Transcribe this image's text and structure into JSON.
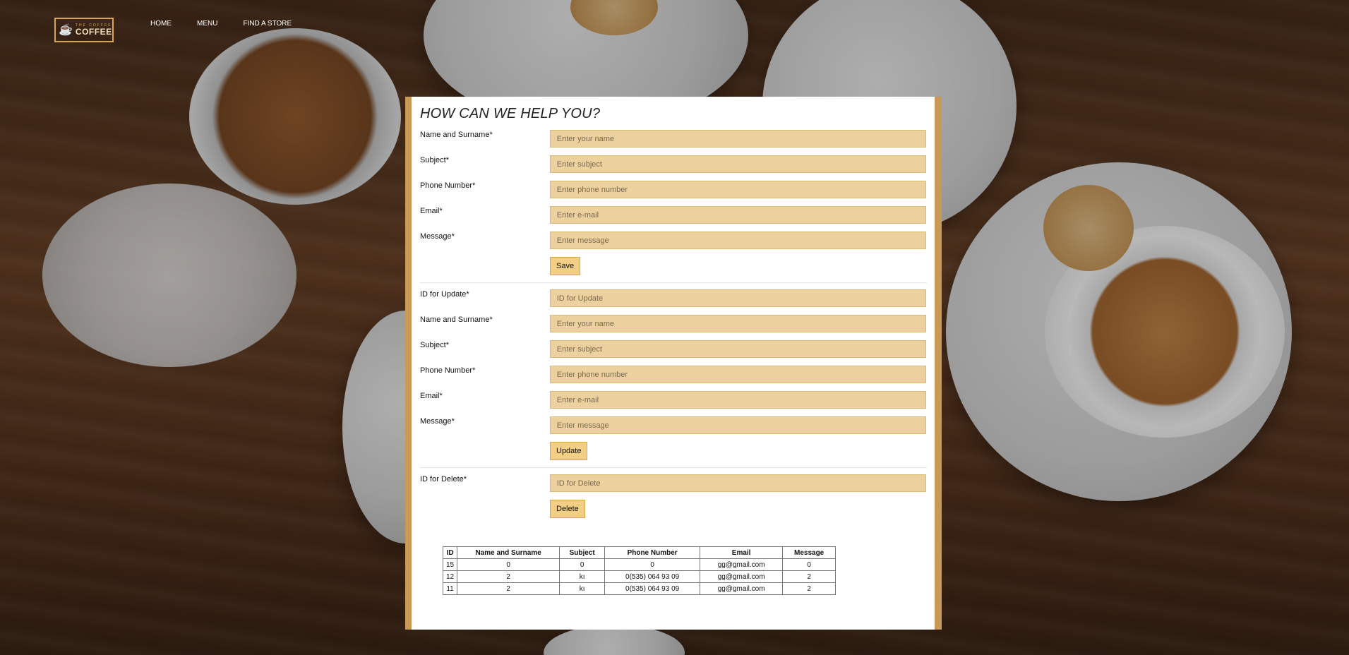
{
  "header": {
    "logo_small": "THE COFFEE",
    "logo_big": "COFFEE",
    "nav": [
      "HOME",
      "MENU",
      "FIND A STORE"
    ]
  },
  "form": {
    "title": "HOW CAN WE HELP YOU?",
    "save_section": {
      "fields": [
        {
          "label": "Name and Surname*",
          "placeholder": "Enter your name"
        },
        {
          "label": "Subject*",
          "placeholder": "Enter subject"
        },
        {
          "label": "Phone Number*",
          "placeholder": "Enter phone number"
        },
        {
          "label": "Email*",
          "placeholder": "Enter e-mail"
        },
        {
          "label": "Message*",
          "placeholder": "Enter message"
        }
      ],
      "button": "Save"
    },
    "update_section": {
      "fields": [
        {
          "label": "ID for Update*",
          "placeholder": "ID for Update"
        },
        {
          "label": "Name and Surname*",
          "placeholder": "Enter your name"
        },
        {
          "label": "Subject*",
          "placeholder": "Enter subject"
        },
        {
          "label": "Phone Number*",
          "placeholder": "Enter phone number"
        },
        {
          "label": "Email*",
          "placeholder": "Enter e-mail"
        },
        {
          "label": "Message*",
          "placeholder": "Enter message"
        }
      ],
      "button": "Update"
    },
    "delete_section": {
      "fields": [
        {
          "label": "ID for Delete*",
          "placeholder": "ID for Delete"
        }
      ],
      "button": "Delete"
    }
  },
  "table": {
    "headers": [
      "ID",
      "Name and Surname",
      "Subject",
      "Phone Number",
      "Email",
      "Message"
    ],
    "rows": [
      [
        "15",
        "0",
        "0",
        "0",
        "gg@gmail.com",
        "0"
      ],
      [
        "12",
        "2",
        "kı",
        "0(535) 064 93 09",
        "gg@gmail.com",
        "2"
      ],
      [
        "11",
        "2",
        "kı",
        "0(535) 064 93 09",
        "gg@gmail.com",
        "2"
      ]
    ]
  },
  "colors": {
    "field_bg": "#ecd19f",
    "button_bg": "#f2cf84",
    "panel_border": "#c89a55",
    "logo": "#d8a553"
  },
  "icons": {
    "logo": "coffee-cup-icon"
  }
}
